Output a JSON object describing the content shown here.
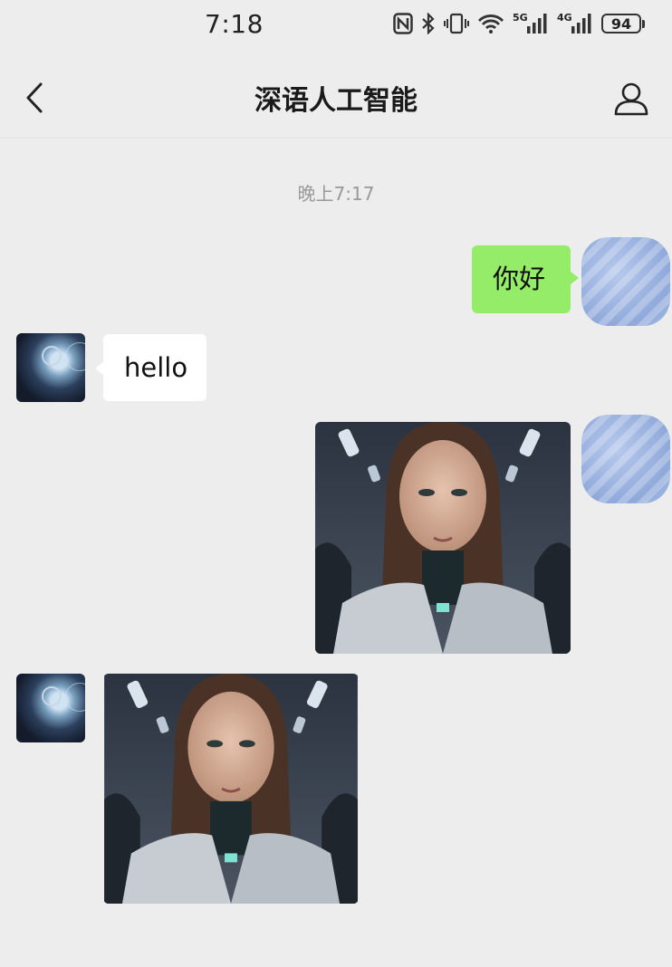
{
  "status_bar": {
    "time": "7:18",
    "battery": "94",
    "net_5g": "5G",
    "net_4g": "4G"
  },
  "header": {
    "title": "深语人工智能"
  },
  "chat": {
    "timestamp": "晚上7:17",
    "messages": [
      {
        "sender": "me",
        "type": "text",
        "text": "你好"
      },
      {
        "sender": "bot",
        "type": "text",
        "text": "hello"
      },
      {
        "sender": "me",
        "type": "image",
        "image": "portrait of woman with cybernetic neck"
      },
      {
        "sender": "bot",
        "type": "image",
        "image": "portrait of woman with cybernetic neck"
      }
    ]
  },
  "icons": {
    "back": "chevron-left-icon",
    "profile": "person-icon"
  },
  "colors": {
    "outgoing_bubble": "#95ec69",
    "incoming_bubble": "#ffffff",
    "background": "#ededed"
  }
}
